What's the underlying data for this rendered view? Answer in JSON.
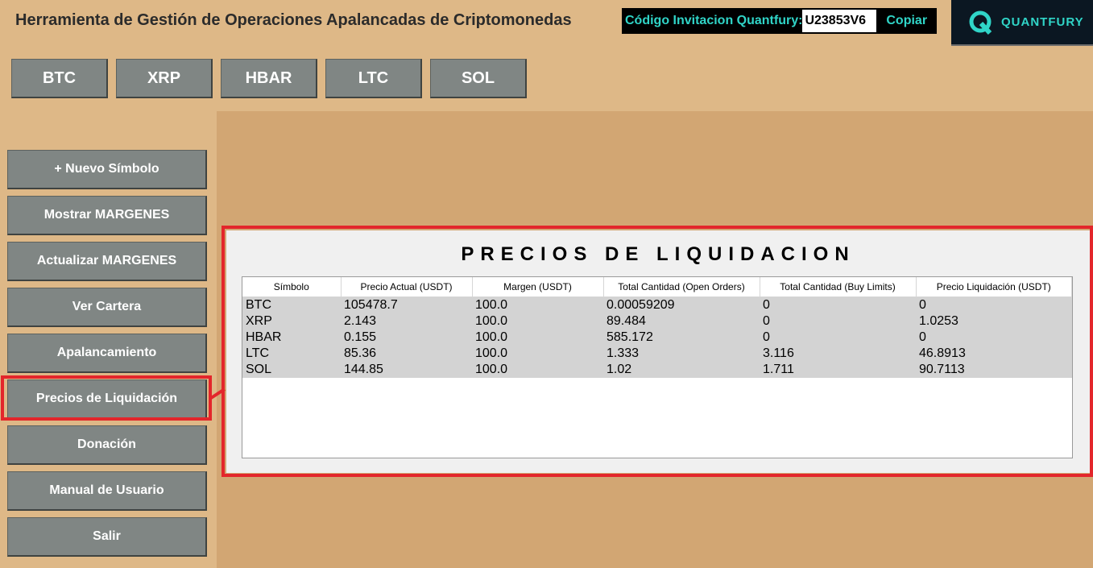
{
  "header": {
    "title": "Herramienta de Gestión de Operaciones Apalancadas de Criptomonedas",
    "invite_label": "Código Invitacion Quantfury:",
    "invite_code": "U23853V6",
    "copy_label": "Copiar"
  },
  "brand": {
    "name": "QUANTFURY",
    "icon": "quantfury-logo",
    "color": "#30D5C8"
  },
  "symbol_tabs": [
    "BTC",
    "XRP",
    "HBAR",
    "LTC",
    "SOL"
  ],
  "sidebar": {
    "items": [
      "+ Nuevo Símbolo",
      "Mostrar MARGENES",
      "Actualizar MARGENES",
      "Ver Cartera",
      "Apalancamiento",
      "Precios de Liquidación",
      "Donación",
      "Manual de Usuario",
      "Salir"
    ],
    "selected": "Precios de Liquidación"
  },
  "panel": {
    "title": "PRECIOS DE LIQUIDACION",
    "columns": [
      "Símbolo",
      "Precio Actual (USDT)",
      "Margen (USDT)",
      "Total Cantidad (Open Orders)",
      "Total Cantidad (Buy Limits)",
      "Precio Liquidación (USDT)"
    ],
    "rows": [
      [
        "BTC",
        "105478.7",
        "100.0",
        "0.00059209",
        "0",
        "0"
      ],
      [
        "XRP",
        "2.143",
        "100.0",
        "89.484",
        "0",
        "1.0253"
      ],
      [
        "HBAR",
        "0.155",
        "100.0",
        "585.172",
        "0",
        "0"
      ],
      [
        "LTC",
        "85.36",
        "100.0",
        "1.333",
        "3.116",
        "46.8913"
      ],
      [
        "SOL",
        "144.85",
        "100.0",
        "1.02",
        "1.711",
        "90.7113"
      ]
    ]
  },
  "colors": {
    "background": "#DEB887",
    "content_area": "#D2A673",
    "button": "#808684",
    "highlight": "#e3262b",
    "accent": "#30D5C8"
  }
}
